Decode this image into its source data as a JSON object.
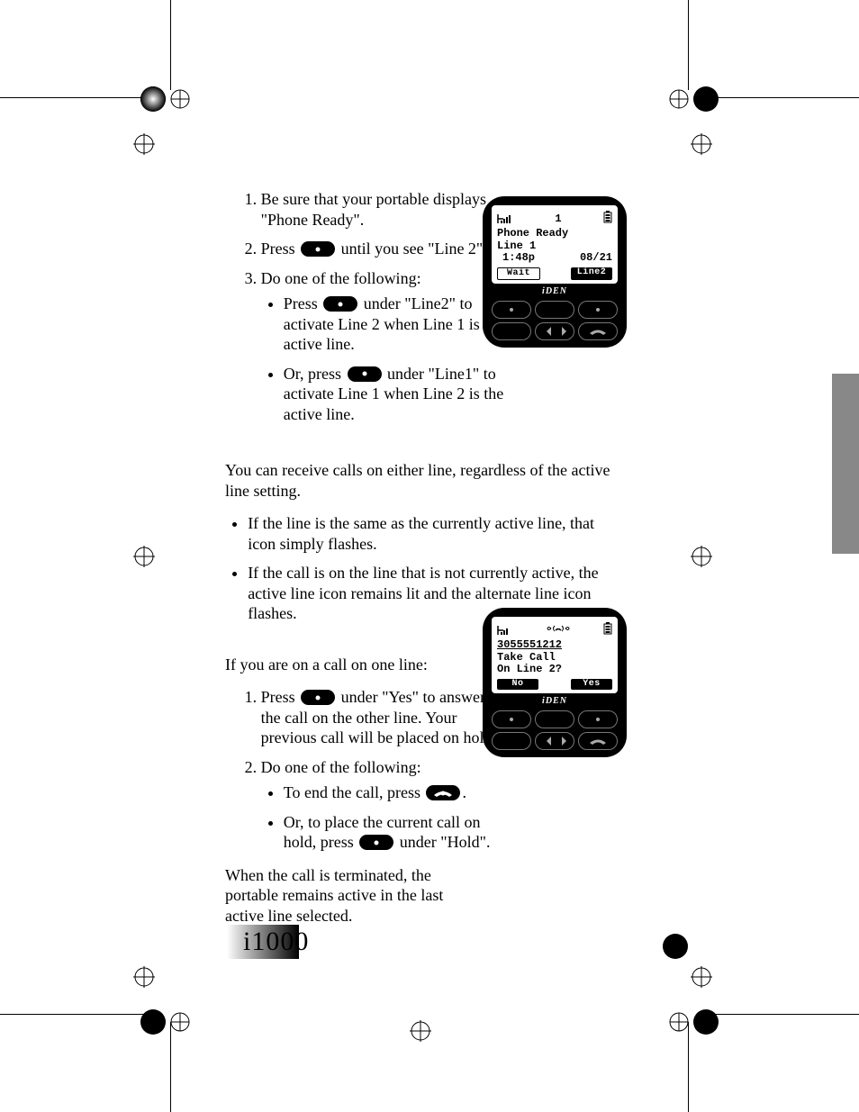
{
  "steps_top": {
    "s1": "Be sure that your portable displays \"Phone Ready\".",
    "s2_a": "Press ",
    "s2_b": " until you see \"Line 2\".",
    "s3": "Do one of the following:",
    "s3_b1_a": "Press ",
    "s3_b1_b": " under \"Line2\" to activate Line 2 when Line 1 is the active line.",
    "s3_b2_a": "Or, press ",
    "s3_b2_b": " under \"Line1\" to activate Line 1 when Line 2 is the active line."
  },
  "middle": {
    "p1": "You can receive calls on either line, regardless of the active line setting.",
    "b1": "If the line is the same as the currently active line, that icon simply flashes.",
    "b2": "If the call is on the line that is not currently active, the active line icon remains lit and the alternate line icon flashes."
  },
  "steps_bottom": {
    "intro": "If you are on a call on one line:",
    "s1_a": "Press ",
    "s1_b": " under \"Yes\" to answer the call on the other line. Your previous call will be placed on hold.",
    "s2": "Do one of the following:",
    "s2_b1_a": "To end the call, press ",
    "s2_b1_b": ".",
    "s2_b2_a": "Or, to place the current call on hold, press ",
    "s2_b2_b": " under \"Hold\".",
    "outro": "When the call is terminated, the portable remains active in the last active line selected."
  },
  "phone1": {
    "ind": "1",
    "l1": "Phone Ready",
    "l2": "Line 1",
    "time": "1:48p",
    "date": "08/21",
    "soft_left": "Wait",
    "soft_right": "Line2",
    "brand": "iDEN"
  },
  "phone2": {
    "num": "3055551212",
    "l1": "Take Call",
    "l2": "On Line 2?",
    "soft_left": "No",
    "soft_right": "Yes",
    "brand": "iDEN"
  },
  "footer": {
    "model": "i1000"
  }
}
